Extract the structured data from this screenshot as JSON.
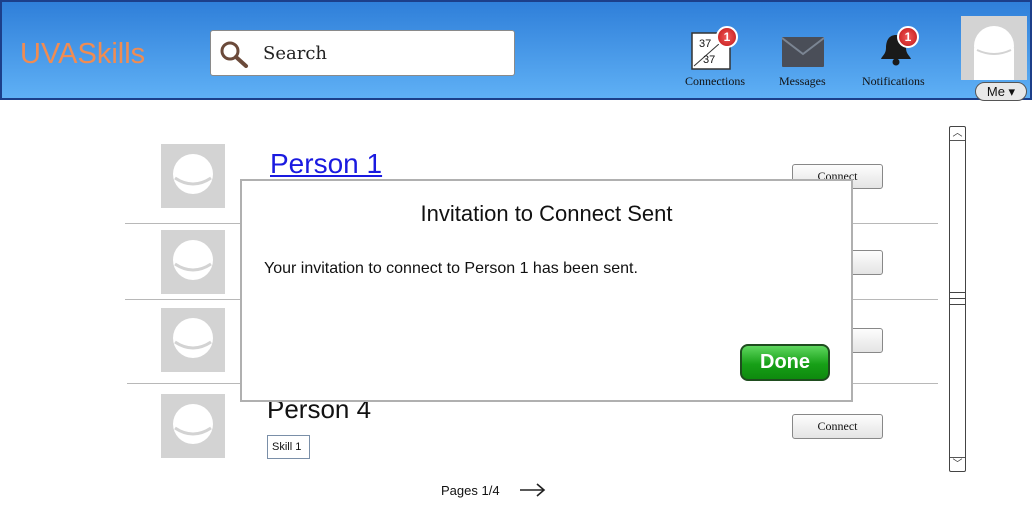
{
  "header": {
    "logo": "UVASkills",
    "search_placeholder": "Search",
    "nav": {
      "connections": {
        "label": "Connections",
        "badge": "1",
        "icon_text_top": "37",
        "icon_text_bottom": "37"
      },
      "messages": {
        "label": "Messages"
      },
      "notifications": {
        "label": "Notifications",
        "badge": "1"
      }
    },
    "me_button": "Me ▾"
  },
  "people": [
    {
      "name": "Person 1",
      "connect_label": "Connect"
    },
    {
      "name": "",
      "connect_label": "t"
    },
    {
      "name": "",
      "connect_label": "t"
    },
    {
      "name": "Person 4",
      "connect_label": "Connect",
      "skill": "Skill 1"
    }
  ],
  "pagination": {
    "label": "Pages 1/4"
  },
  "modal": {
    "title": "Invitation to Connect Sent",
    "message": "Your invitation to connect to Person 1 has been sent.",
    "done_label": "Done"
  },
  "colors": {
    "header_top": "#2f7fd9",
    "header_bottom": "#5fb0f5",
    "logo": "#f08c52",
    "badge": "#d42020",
    "done": "#17a017",
    "link": "#1a1ae0"
  }
}
